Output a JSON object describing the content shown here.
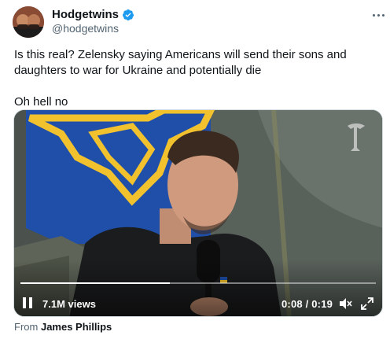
{
  "author": {
    "display_name": "Hodgetwins",
    "handle": "@hodgetwins"
  },
  "tweet": {
    "text_line1": "Is this real? Zelensky saying Americans will send their sons and daughters to war for Ukraine and potentially die",
    "text_line2": "Oh hell no"
  },
  "video": {
    "views": "7.1M views",
    "time": "0:08 / 0:19",
    "progress": 0.42
  },
  "source": {
    "prefix": "From",
    "name": "James Phillips"
  },
  "colors": {
    "verified_blue": "#1d9bf0",
    "flag_blue": "#1f4fa8",
    "flag_gold": "#f2c22e"
  }
}
